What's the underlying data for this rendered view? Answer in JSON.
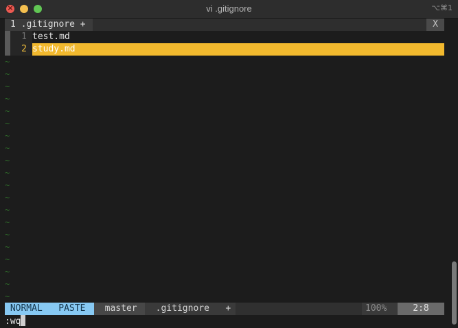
{
  "window": {
    "title": "vi .gitignore",
    "shortcut": "⌥⌘1"
  },
  "tabline": {
    "active_tab": "1 .gitignore +",
    "close_label": "X"
  },
  "buffer": {
    "lines": [
      {
        "number": "1",
        "text": "test.md"
      },
      {
        "number": "2",
        "text": "study.md"
      }
    ],
    "empty_marker": "~"
  },
  "statusline": {
    "mode": "NORMAL",
    "paste": "PASTE",
    "branch": "master",
    "filename": ".gitignore",
    "modified": "+",
    "percent": "100%",
    "position": "2:8"
  },
  "cmdline": {
    "text": ":wq"
  },
  "colors": {
    "mode_bg": "#87c9f3",
    "cursorline_bg": "#f2b92e",
    "tilde": "#2f6d2a"
  }
}
